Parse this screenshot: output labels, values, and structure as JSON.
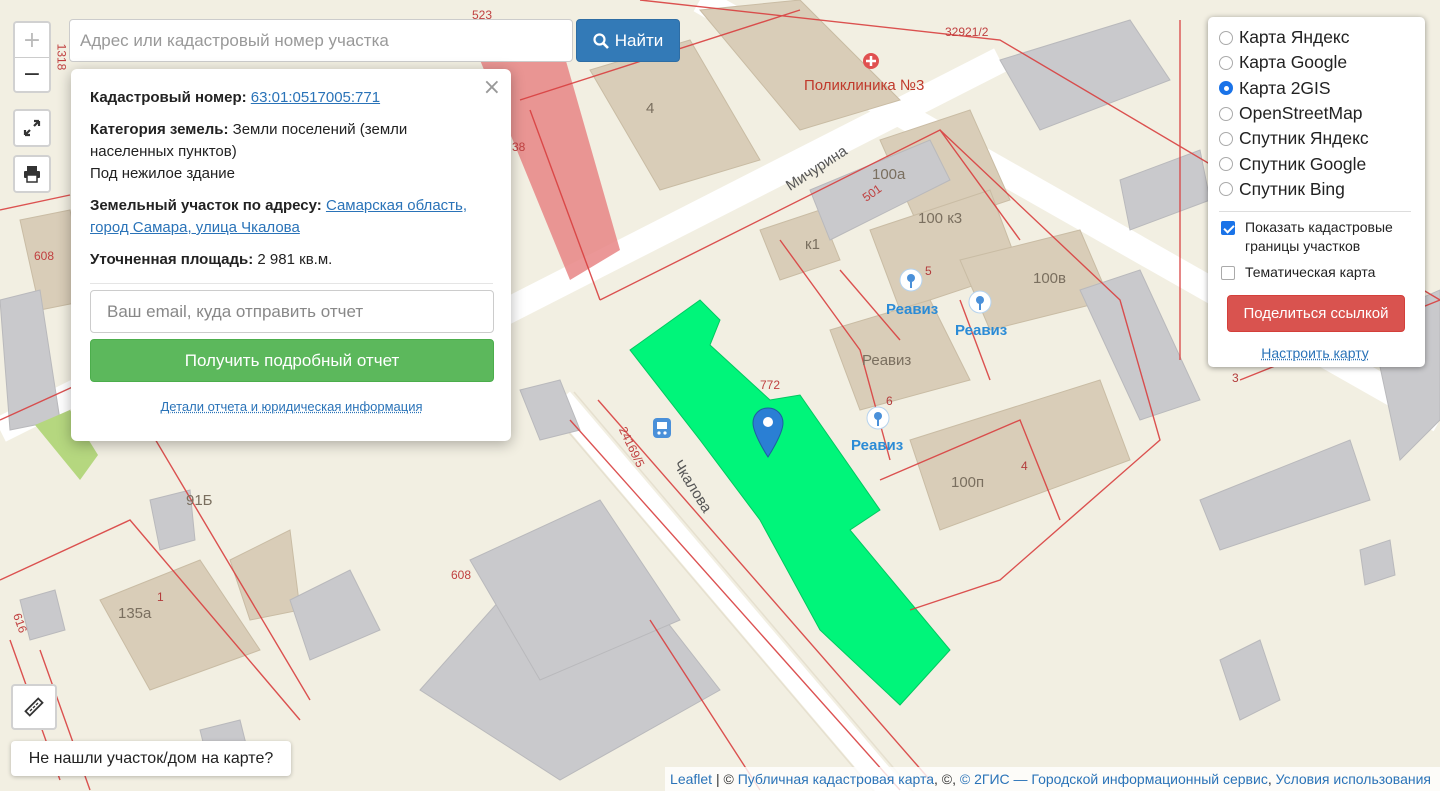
{
  "search": {
    "placeholder": "Адрес или кадастровый номер участка",
    "button_label": "Найти"
  },
  "zoom": {
    "in_label": "+",
    "out_label": "−"
  },
  "popup": {
    "close_label": "×",
    "cadastral_label": "Кадастровый номер:",
    "cadastral_number": "63:01:0517005:771",
    "category_label": "Категория земель:",
    "category_value": "Земли поселений (земли населенных пунктов)",
    "usage": "Под нежилое здание",
    "address_label": "Земельный участок по адресу:",
    "address_value": "Самарская область, город Самара, улица Чкалова",
    "area_label": "Уточненная площадь:",
    "area_value": "2 981 кв.м.",
    "email_placeholder": "Ваш email, куда отправить отчет",
    "report_button": "Получить подробный отчет",
    "details_link": "Детали отчета и юридическая информация"
  },
  "layers": {
    "options": [
      {
        "label": "Карта Яндекс",
        "checked": false
      },
      {
        "label": "Карта Google",
        "checked": false
      },
      {
        "label": "Карта 2GIS",
        "checked": true
      },
      {
        "label": "OpenStreetMap",
        "checked": false
      },
      {
        "label": "Спутник Яндекс",
        "checked": false
      },
      {
        "label": "Спутник Google",
        "checked": false
      },
      {
        "label": "Спутник Bing",
        "checked": false
      }
    ],
    "show_borders_label": "Показать кадастровые границы участков",
    "show_borders_checked": true,
    "thematic_label": "Тематическая карта",
    "thematic_checked": false,
    "share_button": "Поделиться ссылкой",
    "configure_link": "Настроить карту"
  },
  "bottom": {
    "not_found_button": "Не нашли участок/дом на карте?"
  },
  "attribution": {
    "leaflet": "Leaflet",
    "sep1": " | © ",
    "pkk": "Публичная кадастровая карта",
    "sep2": ", ©, ",
    "dgis": "© 2ГИС — Городской информационный сервис",
    "sep3": ", ",
    "terms": "Условия использования"
  },
  "map_labels": {
    "clinic": "Поликлиника №3",
    "street_michurina": "Мичурина",
    "street_chkalova": "Чкалова",
    "reaviz": "Реавиз",
    "b_100a": "100а",
    "b_100k3": "100 к3",
    "b_100v": "100в",
    "b_100p": "100п",
    "b_135a": "135а",
    "b_91b": "91Б",
    "b_k1": "к1",
    "b_4": "4",
    "b_5": "5",
    "b_6": "6",
    "b_1": "1",
    "b_3": "3",
    "b_1b": "1",
    "cad_523": "523",
    "cad_32921": "32921/2",
    "cad_1318": "1318",
    "cad_608a": "608",
    "cad_608b": "608",
    "cad_616": "616",
    "cad_501": "501",
    "cad_772": "772",
    "cad_24169": "24169/5",
    "cad_38": "38"
  },
  "colors": {
    "map_bg": "#f2efe2",
    "building": "#d9cdb8",
    "industrial": "#c9c9cc",
    "selected_parcel": "#00f57a",
    "cadastral_line": "#d94040",
    "highlight_parcel": "#e87e7e",
    "primary": "#337ab7",
    "success": "#5cb85c",
    "danger": "#d9534f"
  },
  "icons": [
    "plus-icon",
    "minus-icon",
    "fullscreen-icon",
    "print-icon",
    "search-icon",
    "ruler-icon",
    "map-pin-icon",
    "bus-stop-icon",
    "reaviz-poi-icon",
    "clinic-icon"
  ]
}
